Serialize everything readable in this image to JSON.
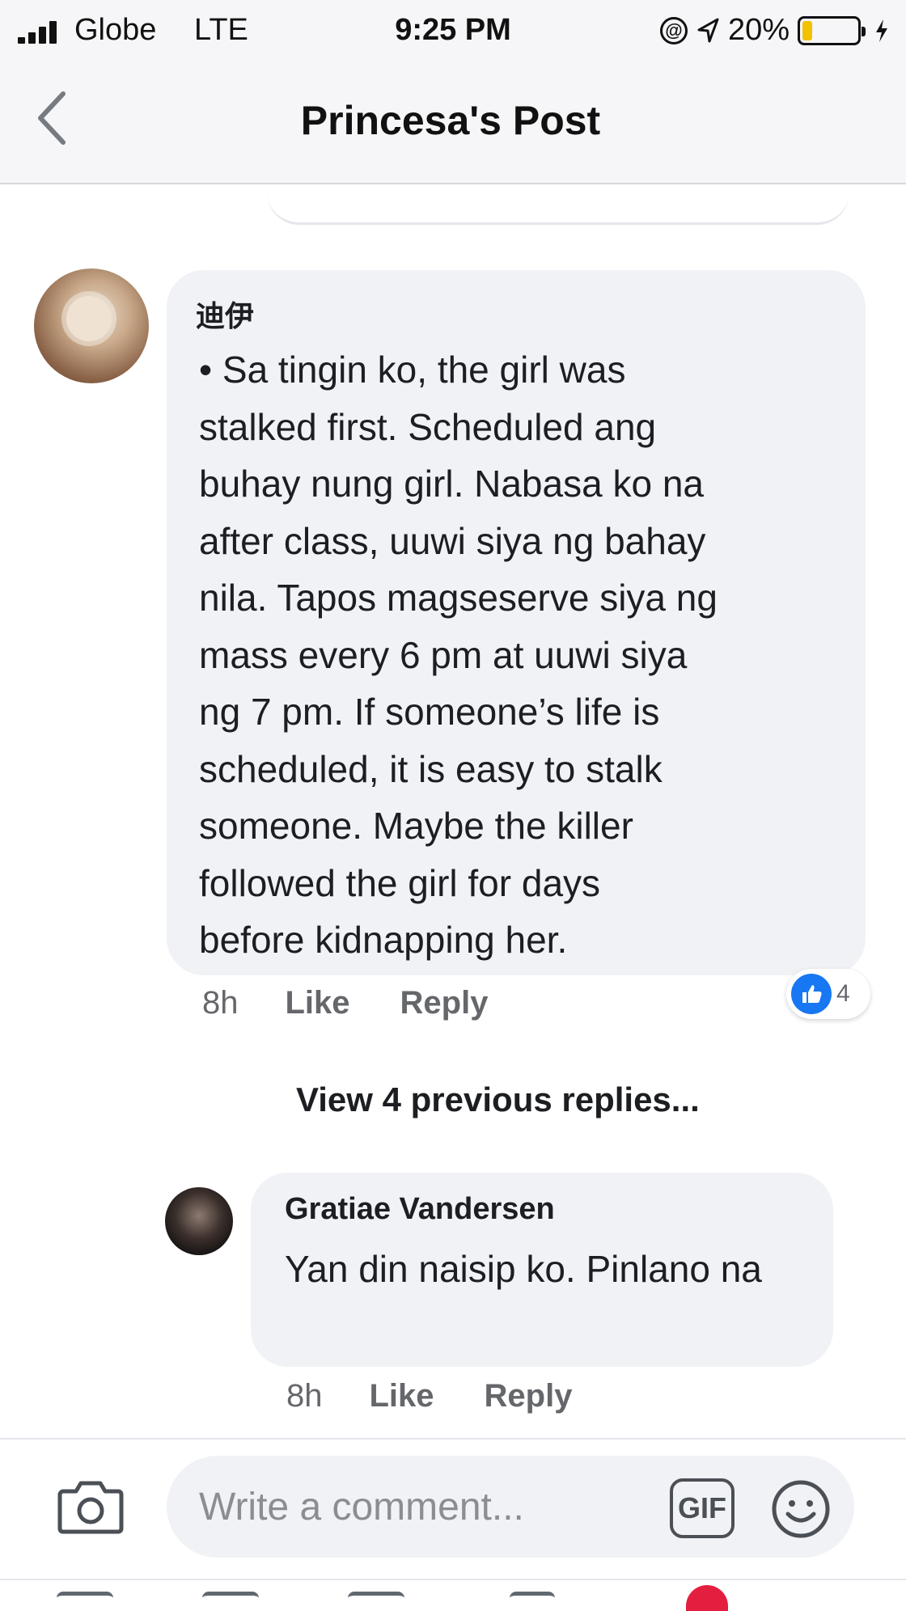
{
  "status_bar": {
    "carrier": "Globe",
    "network": "LTE",
    "time": "9:25 PM",
    "battery_percent": "20%",
    "battery_level": 0.2,
    "signal_bars": 4
  },
  "header": {
    "title": "Princesa's Post",
    "back_icon": "chevron-left-icon"
  },
  "comment": {
    "author": "迪伊",
    "text": "• Sa tingin ko, the girl was\nstalked first. Scheduled ang\nbuhay nung girl. Nabasa ko na\nafter class, uuwi siya ng bahay\nnila. Tapos magseserve siya ng\nmass every 6 pm at uuwi siya\nng 7 pm. If someone’s life is\nscheduled, it is easy to stalk\nsomeone. Maybe the killer\nfollowed the girl for days\nbefore kidnapping her.",
    "time": "8h",
    "like_label": "Like",
    "reply_label": "Reply",
    "reaction_icon": "thumbs-up-icon",
    "reaction_count": "4"
  },
  "view_previous": "View 4 previous replies...",
  "reply": {
    "author": "Gratiae Vandersen",
    "text": "Yan din naisip ko. Pinlano na",
    "time": "8h",
    "like_label": "Like",
    "reply_label": "Reply"
  },
  "composer": {
    "placeholder": "Write a comment...",
    "gif_label": "GIF",
    "camera_icon": "camera-icon",
    "emoji_icon": "smiley-icon"
  },
  "colors": {
    "accent": "#1877f2",
    "bubble": "#f0f2f5",
    "meta_text": "#65676b",
    "battery_fill": "#f2c200",
    "notification": "#e41e3f"
  }
}
